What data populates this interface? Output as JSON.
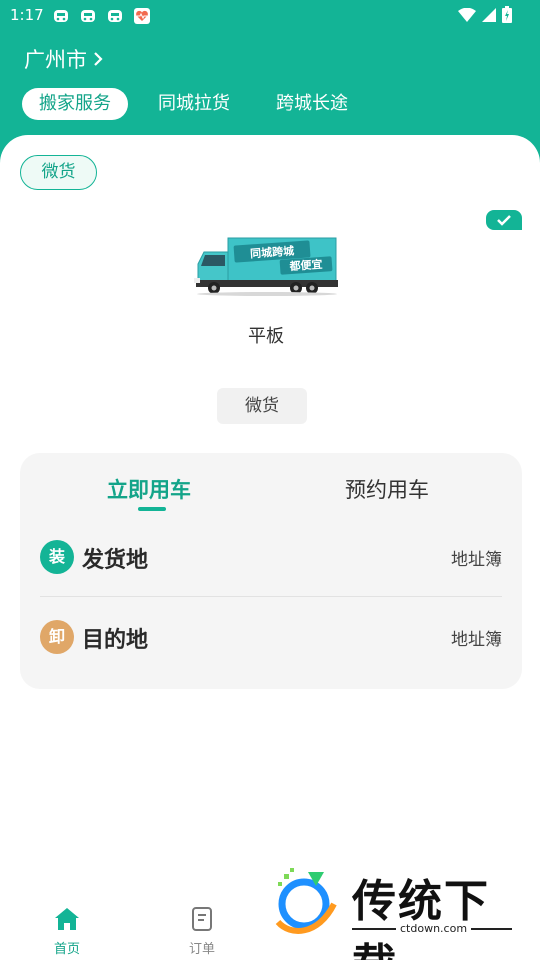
{
  "status_bar": {
    "time": "1:17"
  },
  "header": {
    "city": "广州市"
  },
  "service_tabs": [
    {
      "label": "搬家服务",
      "active": true
    },
    {
      "label": "同城拉货",
      "active": false
    },
    {
      "label": "跨城长途",
      "active": false
    }
  ],
  "category_chip": "微货",
  "vehicle": {
    "name": "平板",
    "truck_banner": [
      "同城跨城",
      "都便宜"
    ],
    "sub_type": "微货"
  },
  "booking": {
    "tab_now": "立即用车",
    "tab_later": "预约用车",
    "pickup": {
      "badge": "装",
      "label": "发货地",
      "address_book": "地址簿"
    },
    "dropoff": {
      "badge": "卸",
      "label": "目的地",
      "address_book": "地址簿"
    }
  },
  "bottom_nav": {
    "home": "首页",
    "orders": "订单"
  },
  "watermark": {
    "title": "传统下载",
    "url": "ctdown.com"
  },
  "colors": {
    "brand": "#13b496",
    "pickup_badge": "#13b496",
    "dropoff_badge": "#e0a768"
  }
}
